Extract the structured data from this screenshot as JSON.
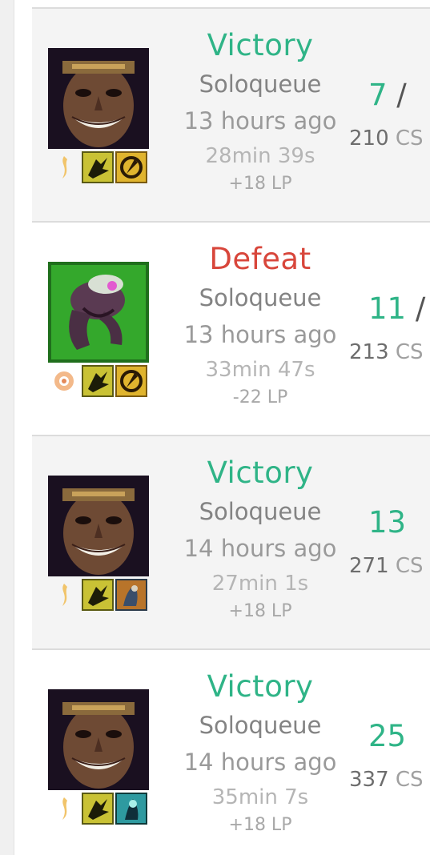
{
  "colors": {
    "victory": "#2fb487",
    "defeat": "#d8463b",
    "kda": "#2fb487"
  },
  "matches": [
    {
      "result": "Victory",
      "queue": "Soloqueue",
      "time_ago": "13 hours ago",
      "duration": "28min 39s",
      "lp": "+18 LP",
      "kda": "7",
      "kda_sep": " /",
      "cs_value": "210",
      "cs_unit": " CS",
      "champion_icon": "draven-portrait",
      "rune_icon": "rune-inspiration-icon",
      "spell1_icon": "ghost-spell-icon",
      "spell2_icon": "cleanse-spell-icon"
    },
    {
      "result": "Defeat",
      "queue": "Soloqueue",
      "time_ago": "13 hours ago",
      "duration": "33min 47s",
      "lp": "-22 LP",
      "kda": "11",
      "kda_sep": " /",
      "cs_value": "213",
      "cs_unit": " CS",
      "champion_icon": "champion-portrait-green",
      "rune_icon": "rune-precision-icon",
      "spell1_icon": "ghost-spell-icon",
      "spell2_icon": "cleanse-spell-icon"
    },
    {
      "result": "Victory",
      "queue": "Soloqueue",
      "time_ago": "14 hours ago",
      "duration": "27min 1s",
      "lp": "+18 LP",
      "kda": "13",
      "kda_sep": "",
      "cs_value": "271",
      "cs_unit": " CS",
      "champion_icon": "draven-portrait",
      "rune_icon": "rune-inspiration-icon",
      "spell1_icon": "ghost-spell-icon",
      "spell2_icon": "exhaust-spell-icon"
    },
    {
      "result": "Victory",
      "queue": "Soloqueue",
      "time_ago": "14 hours ago",
      "duration": "35min 7s",
      "lp": "+18 LP",
      "kda": "25",
      "kda_sep": "",
      "cs_value": "337",
      "cs_unit": " CS",
      "champion_icon": "draven-portrait",
      "rune_icon": "rune-inspiration-icon",
      "spell1_icon": "ghost-spell-icon",
      "spell2_icon": "heal-spell-icon"
    }
  ]
}
